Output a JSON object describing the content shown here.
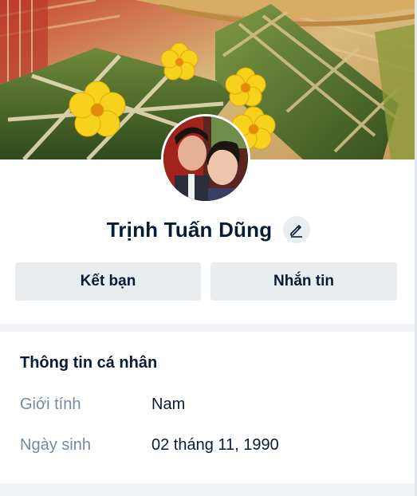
{
  "profile": {
    "name": "Trịnh Tuấn Dũng",
    "cover_image": "banh-chung-tet-cover",
    "avatar_image": "two-people-photo"
  },
  "actions": {
    "add_friend_label": "Kết bạn",
    "message_label": "Nhắn tin",
    "edit_icon": "pencil-icon"
  },
  "personal_info": {
    "title": "Thông tin cá nhân",
    "rows": [
      {
        "label": "Giới tính",
        "value": "Nam"
      },
      {
        "label": "Ngày sinh",
        "value": "02 tháng 11, 1990"
      }
    ]
  },
  "colors": {
    "text_primary": "#081c36",
    "text_secondary": "#7589a3",
    "button_bg": "#eaedf0",
    "page_bg": "#f0f2f5"
  }
}
